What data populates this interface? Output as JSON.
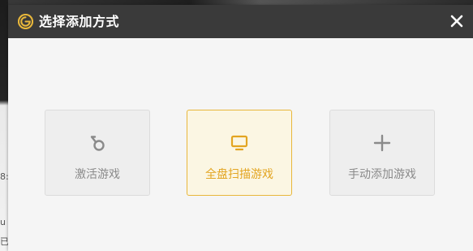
{
  "dialog": {
    "title": "选择添加方式",
    "close_icon": "close-icon",
    "logo_icon": "g-logo-icon",
    "accent_color": "#e8b73b",
    "options": [
      {
        "label": "激活游戏",
        "icon": "key-ring-icon",
        "selected": false
      },
      {
        "label": "全盘扫描游戏",
        "icon": "monitor-icon",
        "selected": true
      },
      {
        "label": "手动添加游戏",
        "icon": "plus-icon",
        "selected": false
      }
    ]
  },
  "background": {
    "left_edge_text": [
      "8:",
      "u",
      "已"
    ]
  }
}
